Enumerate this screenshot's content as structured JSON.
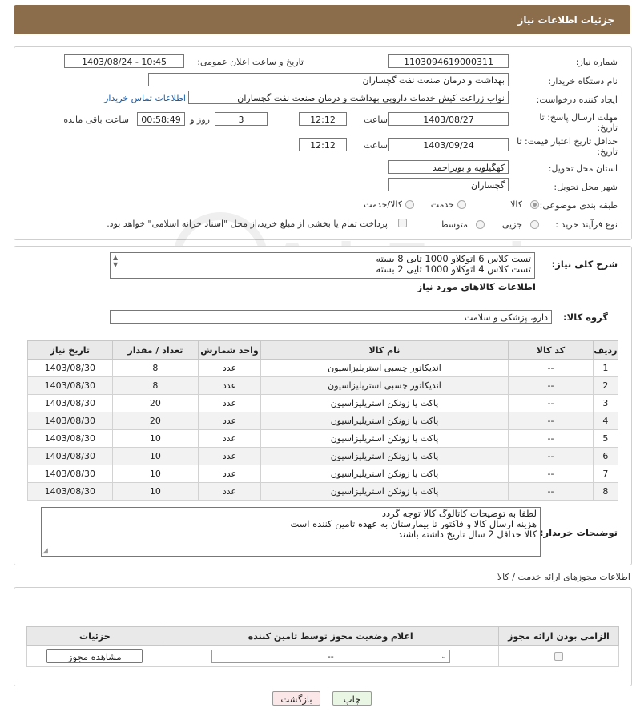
{
  "header": {
    "title": "جزئیات اطلاعات نیاز"
  },
  "form": {
    "need_number_label": "شماره نیاز:",
    "need_number": "1103094619000311",
    "announce_label": "تاریخ و ساعت اعلان عمومی:",
    "announce_value": "1403/08/24 - 10:45",
    "buyer_label": "نام دستگاه خریدار:",
    "buyer_value": "بهداشت و درمان صنعت نفت گچساران",
    "creator_label": "ایجاد کننده درخواست:",
    "creator_value": "نواب زراعت کیش خدمات دارویی بهداشت و درمان صنعت نفت گچساران",
    "contact_link": "اطلاعات تماس خریدار",
    "deadline_label": "مهلت ارسال پاسخ: تا تاریخ:",
    "deadline_date": "1403/08/27",
    "time_label": "ساعت",
    "deadline_time": "12:12",
    "days_value": "3",
    "days_label": "روز و",
    "remaining_value": "00:58:49",
    "remaining_label": "ساعت باقی مانده",
    "validity_label": "حداقل تاریخ اعتبار قیمت: تا تاریخ:",
    "validity_date": "1403/09/24",
    "validity_time": "12:12",
    "province_label": "استان محل تحویل:",
    "province_value": "کهگیلویه و بویراحمد",
    "city_label": "شهر محل تحویل:",
    "city_value": "گچساران",
    "category_label": "طبقه بندی موضوعی:",
    "category_options": [
      "کالا",
      "خدمت",
      "کالا/خدمت"
    ],
    "category_selected": "کالا",
    "process_label": "نوع فرآیند خرید :",
    "process_options": [
      "جزیی",
      "متوسط"
    ],
    "payment_note": "پرداخت تمام یا بخشی از مبلغ خرید،از محل \"اسناد خزانه اسلامی\" خواهد بود."
  },
  "summary": {
    "label": "شرح کلی نیاز:",
    "lines": [
      "تست کلاس 6 اتوکلاو 1000 تایی 8 بسته",
      "تست کلاس 4 اتوکلاو 1000 تایی 2 بسته"
    ],
    "goods_info_title": "اطلاعات کالاهای مورد نیاز",
    "group_label": "گروه کالا:",
    "group_value": "دارو، پزشکی و سلامت"
  },
  "items_table": {
    "headers": [
      "ردیف",
      "کد کالا",
      "نام کالا",
      "واحد شمارش",
      "تعداد / مقدار",
      "تاریخ نیاز"
    ],
    "rows": [
      {
        "row": "1",
        "code": "--",
        "name": "اندیکاتور چسبی استریلیزاسیون",
        "unit": "عدد",
        "qty": "8",
        "date": "1403/08/30"
      },
      {
        "row": "2",
        "code": "--",
        "name": "اندیکاتور چسبی استریلیزاسیون",
        "unit": "عدد",
        "qty": "8",
        "date": "1403/08/30"
      },
      {
        "row": "3",
        "code": "--",
        "name": "پاکت یا زونکن استریلیزاسیون",
        "unit": "عدد",
        "qty": "20",
        "date": "1403/08/30"
      },
      {
        "row": "4",
        "code": "--",
        "name": "پاکت یا زونکن استریلیزاسیون",
        "unit": "عدد",
        "qty": "20",
        "date": "1403/08/30"
      },
      {
        "row": "5",
        "code": "--",
        "name": "پاکت یا زونکن استریلیزاسیون",
        "unit": "عدد",
        "qty": "10",
        "date": "1403/08/30"
      },
      {
        "row": "6",
        "code": "--",
        "name": "پاکت یا زونکن استریلیزاسیون",
        "unit": "عدد",
        "qty": "10",
        "date": "1403/08/30"
      },
      {
        "row": "7",
        "code": "--",
        "name": "پاکت یا زونکن استریلیزاسیون",
        "unit": "عدد",
        "qty": "10",
        "date": "1403/08/30"
      },
      {
        "row": "8",
        "code": "--",
        "name": "پاکت یا زونکن استریلیزاسیون",
        "unit": "عدد",
        "qty": "10",
        "date": "1403/08/30"
      }
    ]
  },
  "buyer_notes": {
    "label": "توضیحات خریدار:",
    "lines": [
      "لطفا به توضیحات کاتالوگ کالا توجه گردد",
      "هزینه ارسال کالا و فاکتور تا بیمارستان به عهده تامین کننده است",
      "کالا حداقل 2 سال تاریخ داشته باشند"
    ]
  },
  "permits": {
    "section_title": "اطلاعات مجوزهای ارائه خدمت / کالا",
    "headers": [
      "الزامی بودن ارائه مجوز",
      "اعلام وضعیت مجوز توسط تامین کننده",
      "جزئیات"
    ],
    "select_value": "--",
    "view_button": "مشاهده مجوز"
  },
  "actions": {
    "print_label": "چاپ",
    "back_label": "بازگشت"
  },
  "watermark": {
    "text": "AriaTender.neT"
  },
  "colors": {
    "header_bg": "#8b6d4b",
    "link": "#1a5ea8",
    "print_btn_bg": "#eaf6e4",
    "back_btn_bg": "#fbe7e7"
  }
}
